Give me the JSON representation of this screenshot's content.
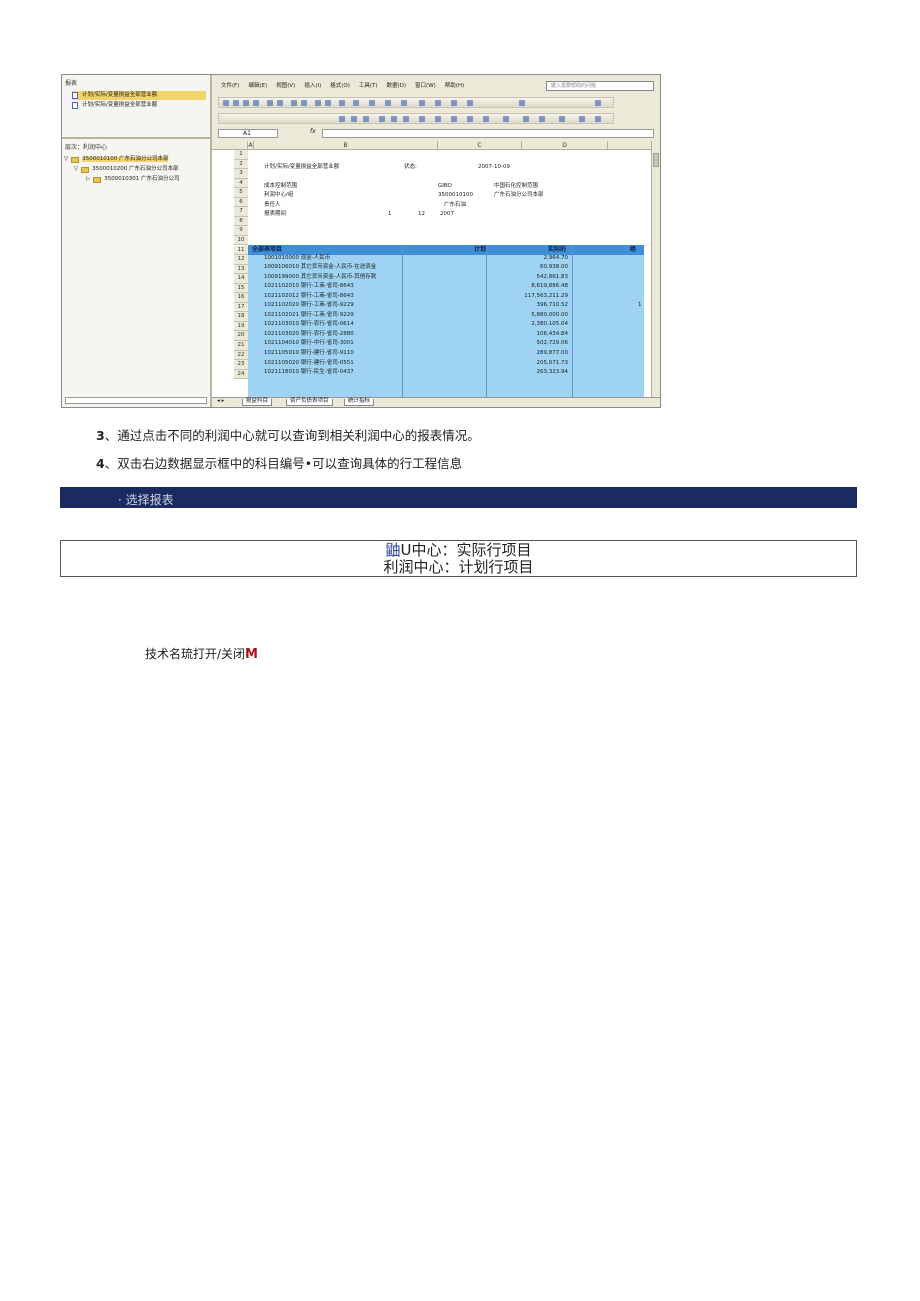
{
  "screenshot": {
    "left_panel": {
      "reports_header": "报表",
      "reports": [
        "计划/实际/变量损益全部营业额",
        "计划/实际/变量损益全部营业额"
      ],
      "tree_header": "层次：利润中心",
      "tree": [
        "3500010100 广东石油分公司本部",
        "3500010200 广东石油分公司本部",
        "3500010301 广东石油分公司"
      ]
    },
    "menu": [
      "文件(F)",
      "编辑(E)",
      "视图(V)",
      "插入(I)",
      "格式(O)",
      "工具(T)",
      "数据(D)",
      "窗口(W)",
      "帮助(H)"
    ],
    "help_placeholder": "键入需要帮助的问题",
    "name_box": "A1",
    "fx": "fx",
    "columns": [
      "A",
      "B",
      "C",
      "D"
    ],
    "header_rows": {
      "r2_title": "计划/实际/变量损益全部营业额",
      "r2_status_label": "状态:",
      "r2_date": "2007-10-09",
      "r4_label": "成本控制范围",
      "r4_code": "GIBO",
      "r4_name": "中国石化控制范围",
      "r5_label": "利润中心/组",
      "r5_code": "3500010100",
      "r5_name": "广东石油分公司本部",
      "r6_label": "责任人",
      "r6_name": "广东石油",
      "r7_label": "报表期间",
      "r7_from": "1",
      "r7_to": "12",
      "r7_year": "2007"
    },
    "table_header": [
      "全部表项目",
      "计划",
      "实际的",
      "绝"
    ],
    "rows": [
      {
        "n": "12",
        "item": "1001010000 现金-人民币",
        "actual": "2,964.70"
      },
      {
        "n": "13",
        "item": "1009106010 其它货币资金-人民币-在途资金",
        "actual": "60,938.00"
      },
      {
        "n": "14",
        "item": "1009199000 其它货币资金-人民币-其他存款",
        "actual": "542,861.83"
      },
      {
        "n": "15",
        "item": "1021102010 银行-工商-省司-8643",
        "actual": "8,619,886.48"
      },
      {
        "n": "16",
        "item": "1021102012 银行-工商-省司-8643",
        "actual": "117,563,211.29"
      },
      {
        "n": "17",
        "item": "1021102020 银行-工商-省司-9229",
        "actual": "396,710.52"
      },
      {
        "n": "18",
        "item": "1021102021 银行-工商-省司-9229",
        "actual": "5,880,000.00"
      },
      {
        "n": "19",
        "item": "1021103010 银行-农行-省司-0614",
        "actual": "2,380,105.04"
      },
      {
        "n": "20",
        "item": "1021103020 银行-农行-省司-2880",
        "actual": "106,434.84"
      },
      {
        "n": "21",
        "item": "1021104010 银行-中行-省司-3001",
        "actual": "502,729.06"
      },
      {
        "n": "22",
        "item": "1021105010 银行-建行-省司-9110",
        "actual": "289,877.00"
      },
      {
        "n": "23",
        "item": "1021105020 银行-建行-省司-0551",
        "actual": "205,071.73"
      },
      {
        "n": "24",
        "item": "1021118010 银行-民生-省司-0437",
        "actual": "263,323.94"
      }
    ],
    "row16_extra": "1",
    "sheet_tabs": [
      "损益科目",
      "资产负债表项目",
      "统计指标"
    ]
  },
  "steps": [
    {
      "num": "3",
      "text": "、通过点击不同的利润中心就可以查询到相关利润中心的报表情况。"
    },
    {
      "num": "4",
      "text": "、双击右边数据显示框中的科目编号•可以查询具体的行工程信息"
    }
  ],
  "banner": "· 选择报表",
  "box": {
    "line1_mark": "鼬",
    "line1_rest": "U中心：实际行项目",
    "line2": "利润中心：计划行项目"
  },
  "note": {
    "text": "技术名琉打开/关闭",
    "mark": "M"
  }
}
